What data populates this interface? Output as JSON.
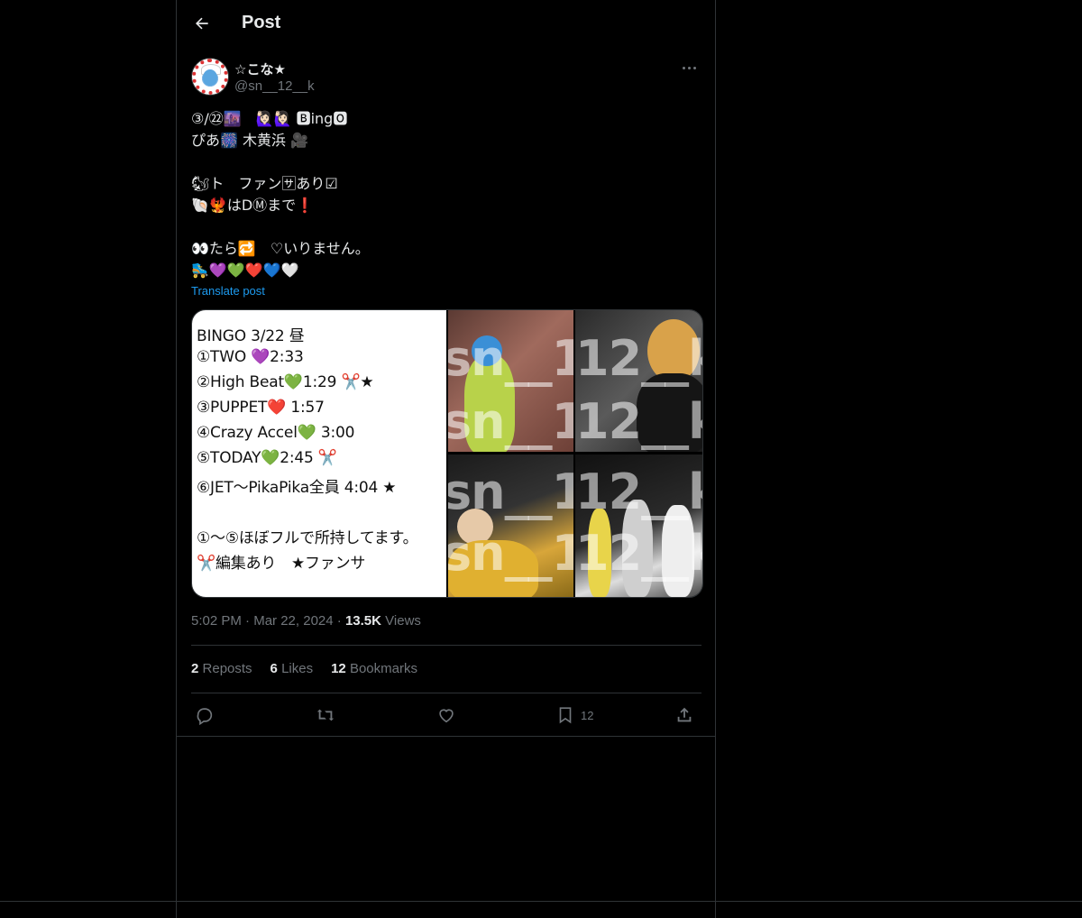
{
  "header": {
    "title": "Post"
  },
  "author": {
    "display_name": "☆こな★",
    "handle": "@sn__12__k"
  },
  "tweet": {
    "text": "③/㉒🌆　🙋🏻‍♀️🙋🏻‍♀️ 🅱ing🅾\nぴあ🎆 木黄浜 🎥\n\n🐿ト　ファン🈂あり☑\n🐚🐦‍🔥はDⓂまで❗\n\n👀たら🔁　♡いりません。\n🛼💜💚❤️💙🤍",
    "translate_label": "Translate post"
  },
  "media": {
    "setlist": [
      "BINGO 3/22 昼",
      "①TWO 💜2:33",
      "②High Beat💚1:29 ✂️★",
      "③PUPPET❤️ 1:57",
      "④Crazy Accel💚 3:00",
      "⑤TODAY💚2:45 ✂️",
      "⑥JET～PikaPika全員 4:04 ★",
      "",
      "①～⑤ほぼフルで所持してます。",
      "✂️編集あり　★ファンサ"
    ],
    "watermark_top": "sn__12__",
    "watermark_bottom": "12__k"
  },
  "meta": {
    "time": "5:02 PM",
    "date": "Mar 22, 2024",
    "views_count": "13.5K",
    "views_label": "Views",
    "sep": "·"
  },
  "stats": {
    "reposts_count": "2",
    "reposts_label": "Reposts",
    "likes_count": "6",
    "likes_label": "Likes",
    "bookmarks_count": "12",
    "bookmarks_label": "Bookmarks"
  },
  "actions": {
    "bookmark_count": "12"
  }
}
